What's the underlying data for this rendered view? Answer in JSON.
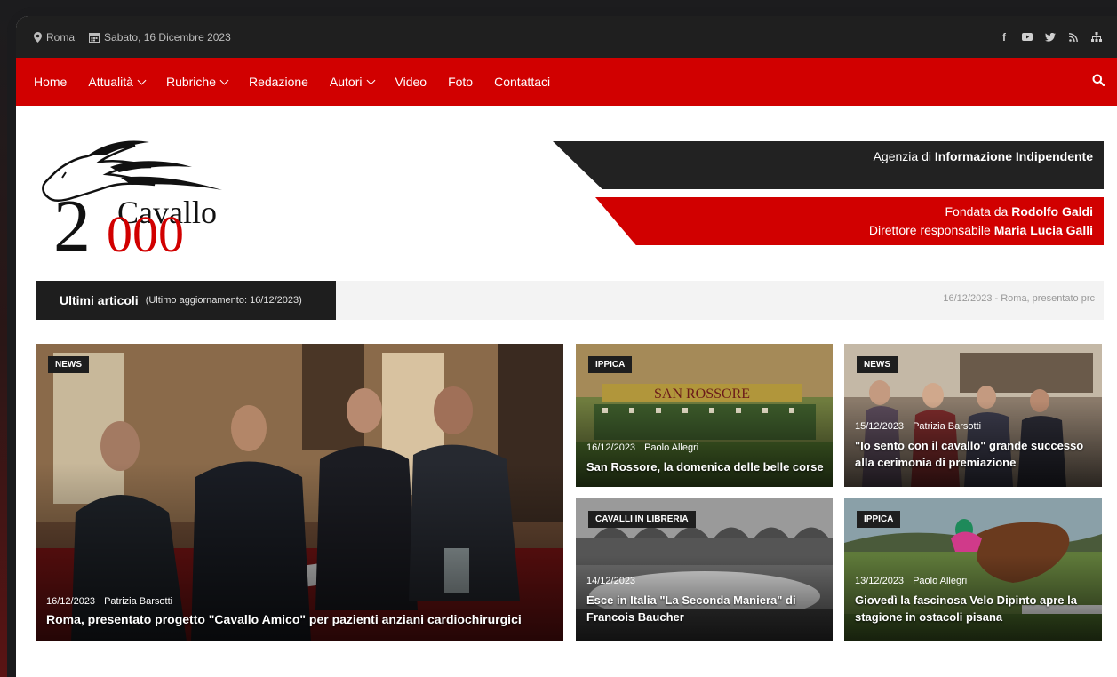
{
  "topbar": {
    "location": "Roma",
    "date": "Sabato, 16 Dicembre 2023",
    "social": [
      "facebook-icon",
      "youtube-icon",
      "twitter-icon",
      "rss-icon",
      "sitemap-icon"
    ]
  },
  "nav": {
    "items": [
      {
        "label": "Home",
        "dropdown": false
      },
      {
        "label": "Attualità",
        "dropdown": true
      },
      {
        "label": "Rubriche",
        "dropdown": true
      },
      {
        "label": "Redazione",
        "dropdown": false
      },
      {
        "label": "Autori",
        "dropdown": true
      },
      {
        "label": "Video",
        "dropdown": false
      },
      {
        "label": "Foto",
        "dropdown": false
      },
      {
        "label": "Contattaci",
        "dropdown": false
      }
    ]
  },
  "logo": {
    "number_prefix": "2",
    "name": "Cavallo",
    "number_suffix": "000"
  },
  "header": {
    "tagline_pre": "Agenzia di",
    "tagline_strong": "Informazione Indipendente",
    "founded_pre": "Fondata da",
    "founded_name": "Rodolfo Galdi",
    "director_pre": "Direttore responsabile",
    "director_name": "Maria Lucia Galli"
  },
  "ticker": {
    "label": "Ultimi articoli",
    "updated": "(Ultimo aggiornamento: 16/12/2023)",
    "news": "16/12/2023 - Roma, presentato prc"
  },
  "articles": [
    {
      "badge": "NEWS",
      "date": "16/12/2023",
      "author": "Patrizia Barsotti",
      "title": "Roma, presentato progetto \"Cavallo Amico\" per pazienti anziani cardiochirurgici"
    },
    {
      "badge": "IPPICA",
      "date": "16/12/2023",
      "author": "Paolo Allegri",
      "title": "San Rossore, la domenica delle belle corse",
      "sign": "SAN ROSSORE"
    },
    {
      "badge": "NEWS",
      "date": "15/12/2023",
      "author": "Patrizia Barsotti",
      "title": "\"Io sento con il cavallo\" grande successo alla cerimonia di premiazione"
    },
    {
      "badge": "CAVALLI IN LIBRERIA",
      "date": "14/12/2023",
      "author": "",
      "title": "Esce in Italia \"La Seconda Maniera\" di Francois Baucher"
    },
    {
      "badge": "IPPICA",
      "date": "13/12/2023",
      "author": "Paolo Allegri",
      "title": "Giovedì la fascinosa Velo Dipinto apre la stagione in ostacoli pisana"
    }
  ]
}
